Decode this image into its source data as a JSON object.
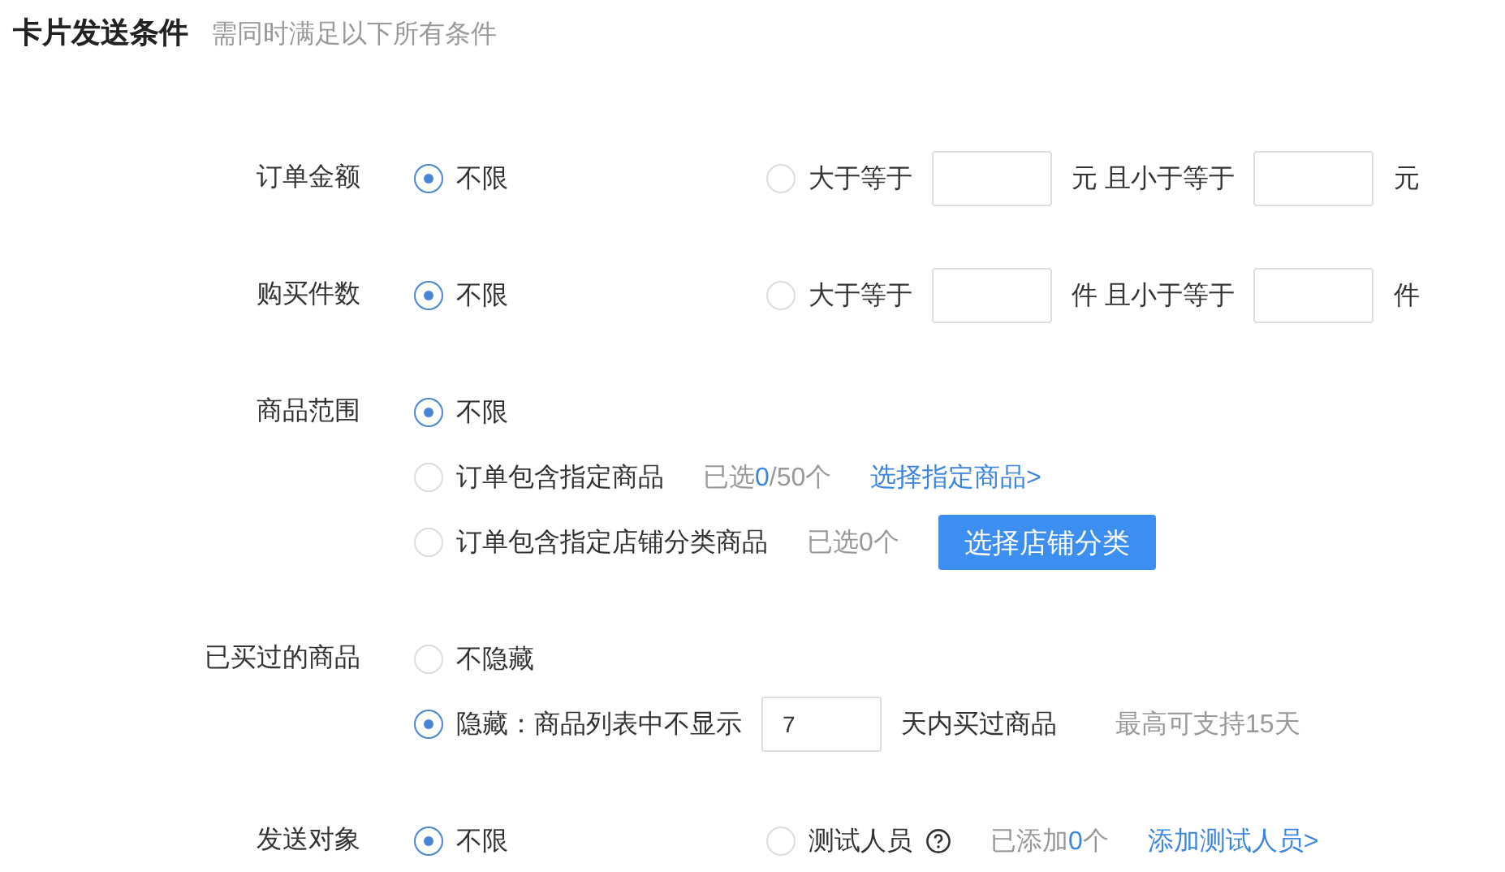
{
  "header": {
    "title": "卡片发送条件",
    "subtitle": "需同时满足以下所有条件"
  },
  "rows": [
    {
      "label": "订单金额",
      "kind": "inline",
      "options": [
        {
          "selected": true,
          "parts": [
            {
              "kind": "text",
              "text": "不限"
            }
          ]
        },
        {
          "selected": false,
          "parts": [
            {
              "kind": "text",
              "text": "大于等于"
            },
            {
              "kind": "field"
            },
            {
              "kind": "text",
              "text": "元 且小于等于"
            },
            {
              "kind": "field"
            },
            {
              "kind": "text",
              "text": "元"
            }
          ]
        }
      ]
    },
    {
      "label": "购买件数",
      "kind": "inline",
      "options": [
        {
          "selected": true,
          "parts": [
            {
              "kind": "text",
              "text": "不限"
            }
          ]
        },
        {
          "selected": false,
          "parts": [
            {
              "kind": "text",
              "text": "大于等于"
            },
            {
              "kind": "field"
            },
            {
              "kind": "text",
              "text": "件 且小于等于"
            },
            {
              "kind": "field"
            },
            {
              "kind": "text",
              "text": "件"
            }
          ]
        }
      ]
    },
    {
      "label": "商品范围",
      "kind": "stacked",
      "options": [
        {
          "selected": true,
          "parts": [
            {
              "kind": "text",
              "text": "不限"
            }
          ]
        },
        {
          "selected": false,
          "parts": [
            {
              "kind": "text",
              "text": "订单包含指定商品"
            },
            {
              "kind": "count",
              "prefix": "已选",
              "value": "0",
              "suffix": "/50个",
              "highlighted": true
            },
            {
              "kind": "link",
              "text": "选择指定商品>"
            }
          ]
        },
        {
          "selected": false,
          "parts": [
            {
              "kind": "text",
              "text": "订单包含指定店铺分类商品"
            },
            {
              "kind": "count",
              "prefix": "已选",
              "value": "0",
              "suffix": "个",
              "highlighted": false
            },
            {
              "kind": "button",
              "text": "选择店铺分类"
            }
          ]
        }
      ]
    },
    {
      "label": "已买过的商品",
      "kind": "stacked",
      "options": [
        {
          "selected": false,
          "parts": [
            {
              "kind": "text",
              "text": "不隐藏"
            }
          ]
        },
        {
          "selected": true,
          "parts": [
            {
              "kind": "text",
              "text": "隐藏：商品列表中不显示"
            },
            {
              "kind": "field",
              "value": "7"
            },
            {
              "kind": "text",
              "text": "天内买过商品"
            },
            {
              "kind": "hint",
              "text": "最高可支持15天"
            }
          ]
        }
      ]
    },
    {
      "label": "发送对象",
      "kind": "inline",
      "options": [
        {
          "selected": true,
          "parts": [
            {
              "kind": "text",
              "text": "不限"
            }
          ]
        },
        {
          "selected": false,
          "parts": [
            {
              "kind": "text",
              "text": "测试人员"
            },
            {
              "kind": "help"
            },
            {
              "kind": "count",
              "prefix": "已添加",
              "value": "0",
              "suffix": "个",
              "highlighted": true
            },
            {
              "kind": "link",
              "text": "添加测试人员>"
            }
          ]
        }
      ]
    }
  ]
}
